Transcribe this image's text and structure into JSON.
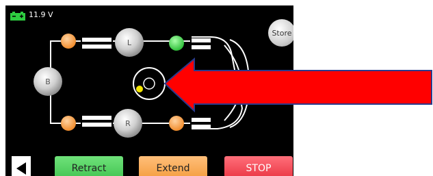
{
  "status": {
    "battery_voltage": "11.9 V",
    "battery_color": "#2ecc40"
  },
  "store_button": {
    "label": "Store"
  },
  "nodes": {
    "left": "B",
    "top": "L",
    "bottom": "R"
  },
  "bottom_bar": {
    "back_icon": "triangle-left-icon",
    "retract_label": "Retract",
    "extend_label": "Extend",
    "stop_label": "STOP"
  },
  "colors": {
    "node_orange": "#f39a3a",
    "node_green": "#3fd24a",
    "arrow": "#ff0000",
    "dot_yellow": "#f5e600"
  }
}
